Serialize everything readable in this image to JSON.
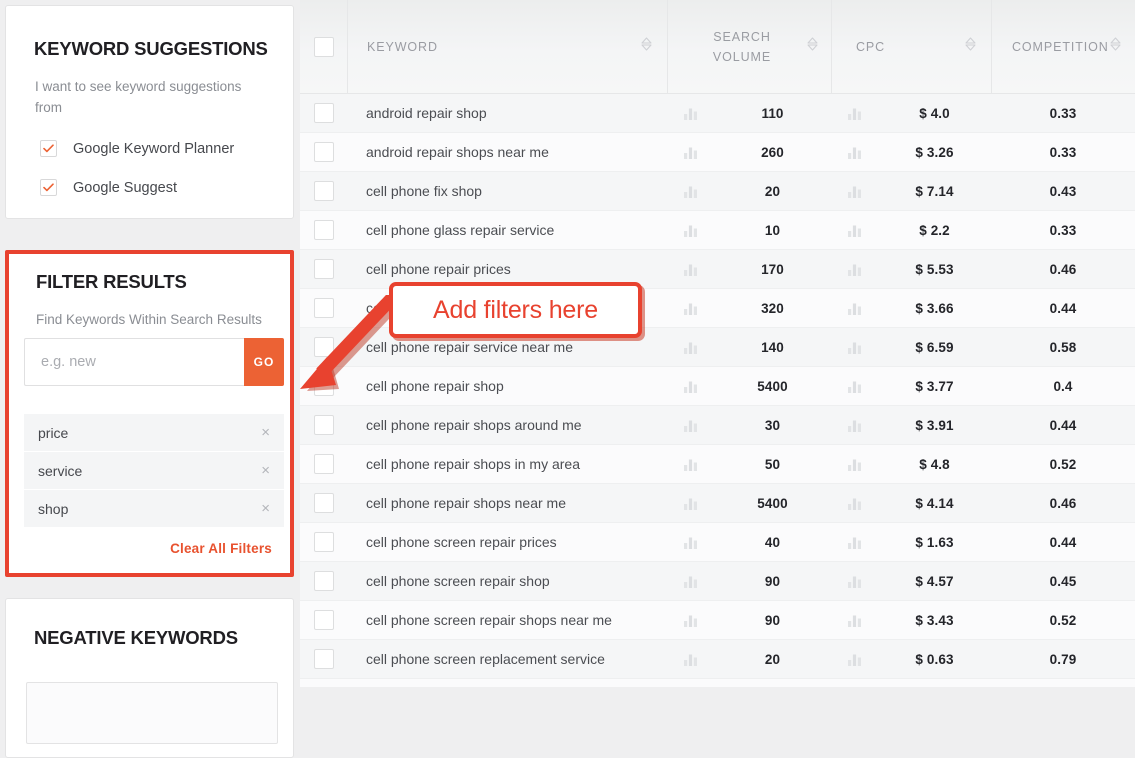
{
  "sidebar": {
    "keyword_suggestions": {
      "title": "KEYWORD SUGGESTIONS",
      "subtitle": "I want to see keyword suggestions from",
      "sources": [
        {
          "label": "Google Keyword Planner",
          "checked": true
        },
        {
          "label": "Google Suggest",
          "checked": true
        }
      ]
    },
    "filter_results": {
      "title": "FILTER RESULTS",
      "subtitle": "Find Keywords Within Search Results",
      "input_value": "",
      "input_placeholder": "e.g. new",
      "go_label": "GO",
      "tags": [
        "price",
        "service",
        "shop"
      ],
      "remove_glyph": "×",
      "clear_all_label": "Clear All Filters",
      "highlight_color": "#e8422f",
      "accent_color": "#ec6234"
    },
    "negative_keywords": {
      "title": "NEGATIVE KEYWORDS"
    }
  },
  "annotation": {
    "text": "Add filters here",
    "color": "#e8422f"
  },
  "table": {
    "select_all_checkbox": false,
    "columns": [
      {
        "key": "keyword",
        "label": "KEYWORD",
        "sortable": true
      },
      {
        "key": "volume",
        "label": "SEARCH VOLUME",
        "label_lines": [
          "SEARCH",
          "VOLUME"
        ],
        "sortable": true
      },
      {
        "key": "cpc",
        "label": "CPC",
        "sortable": true
      },
      {
        "key": "competition",
        "label": "COMPETITION",
        "sortable": true
      }
    ],
    "trend_icon": "bar-chart-icon",
    "rows": [
      {
        "keyword": "android repair shop",
        "volume": "110",
        "cpc": "$ 4.0",
        "competition": "0.33"
      },
      {
        "keyword": "android repair shops near me",
        "volume": "260",
        "cpc": "$ 3.26",
        "competition": "0.33"
      },
      {
        "keyword": "cell phone fix shop",
        "volume": "20",
        "cpc": "$ 7.14",
        "competition": "0.43"
      },
      {
        "keyword": "cell phone glass repair service",
        "volume": "10",
        "cpc": "$ 2.2",
        "competition": "0.33"
      },
      {
        "keyword": "cell phone repair prices",
        "volume": "170",
        "cpc": "$ 5.53",
        "competition": "0.46"
      },
      {
        "keyword": "cell",
        "volume": "320",
        "cpc": "$ 3.66",
        "competition": "0.44"
      },
      {
        "keyword": "cell phone repair service near me",
        "volume": "140",
        "cpc": "$ 6.59",
        "competition": "0.58"
      },
      {
        "keyword": "cell phone repair shop",
        "volume": "5400",
        "cpc": "$ 3.77",
        "competition": "0.4"
      },
      {
        "keyword": "cell phone repair shops around me",
        "volume": "30",
        "cpc": "$ 3.91",
        "competition": "0.44"
      },
      {
        "keyword": "cell phone repair shops in my area",
        "volume": "50",
        "cpc": "$ 4.8",
        "competition": "0.52"
      },
      {
        "keyword": "cell phone repair shops near me",
        "volume": "5400",
        "cpc": "$ 4.14",
        "competition": "0.46"
      },
      {
        "keyword": "cell phone screen repair prices",
        "volume": "40",
        "cpc": "$ 1.63",
        "competition": "0.44"
      },
      {
        "keyword": "cell phone screen repair shop",
        "volume": "90",
        "cpc": "$ 4.57",
        "competition": "0.45"
      },
      {
        "keyword": "cell phone screen repair shops near me",
        "volume": "90",
        "cpc": "$ 3.43",
        "competition": "0.52"
      },
      {
        "keyword": "cell phone screen replacement service",
        "volume": "20",
        "cpc": "$ 0.63",
        "competition": "0.79"
      },
      {
        "keyword": "",
        "volume": "",
        "cpc": "",
        "competition": ""
      }
    ]
  }
}
